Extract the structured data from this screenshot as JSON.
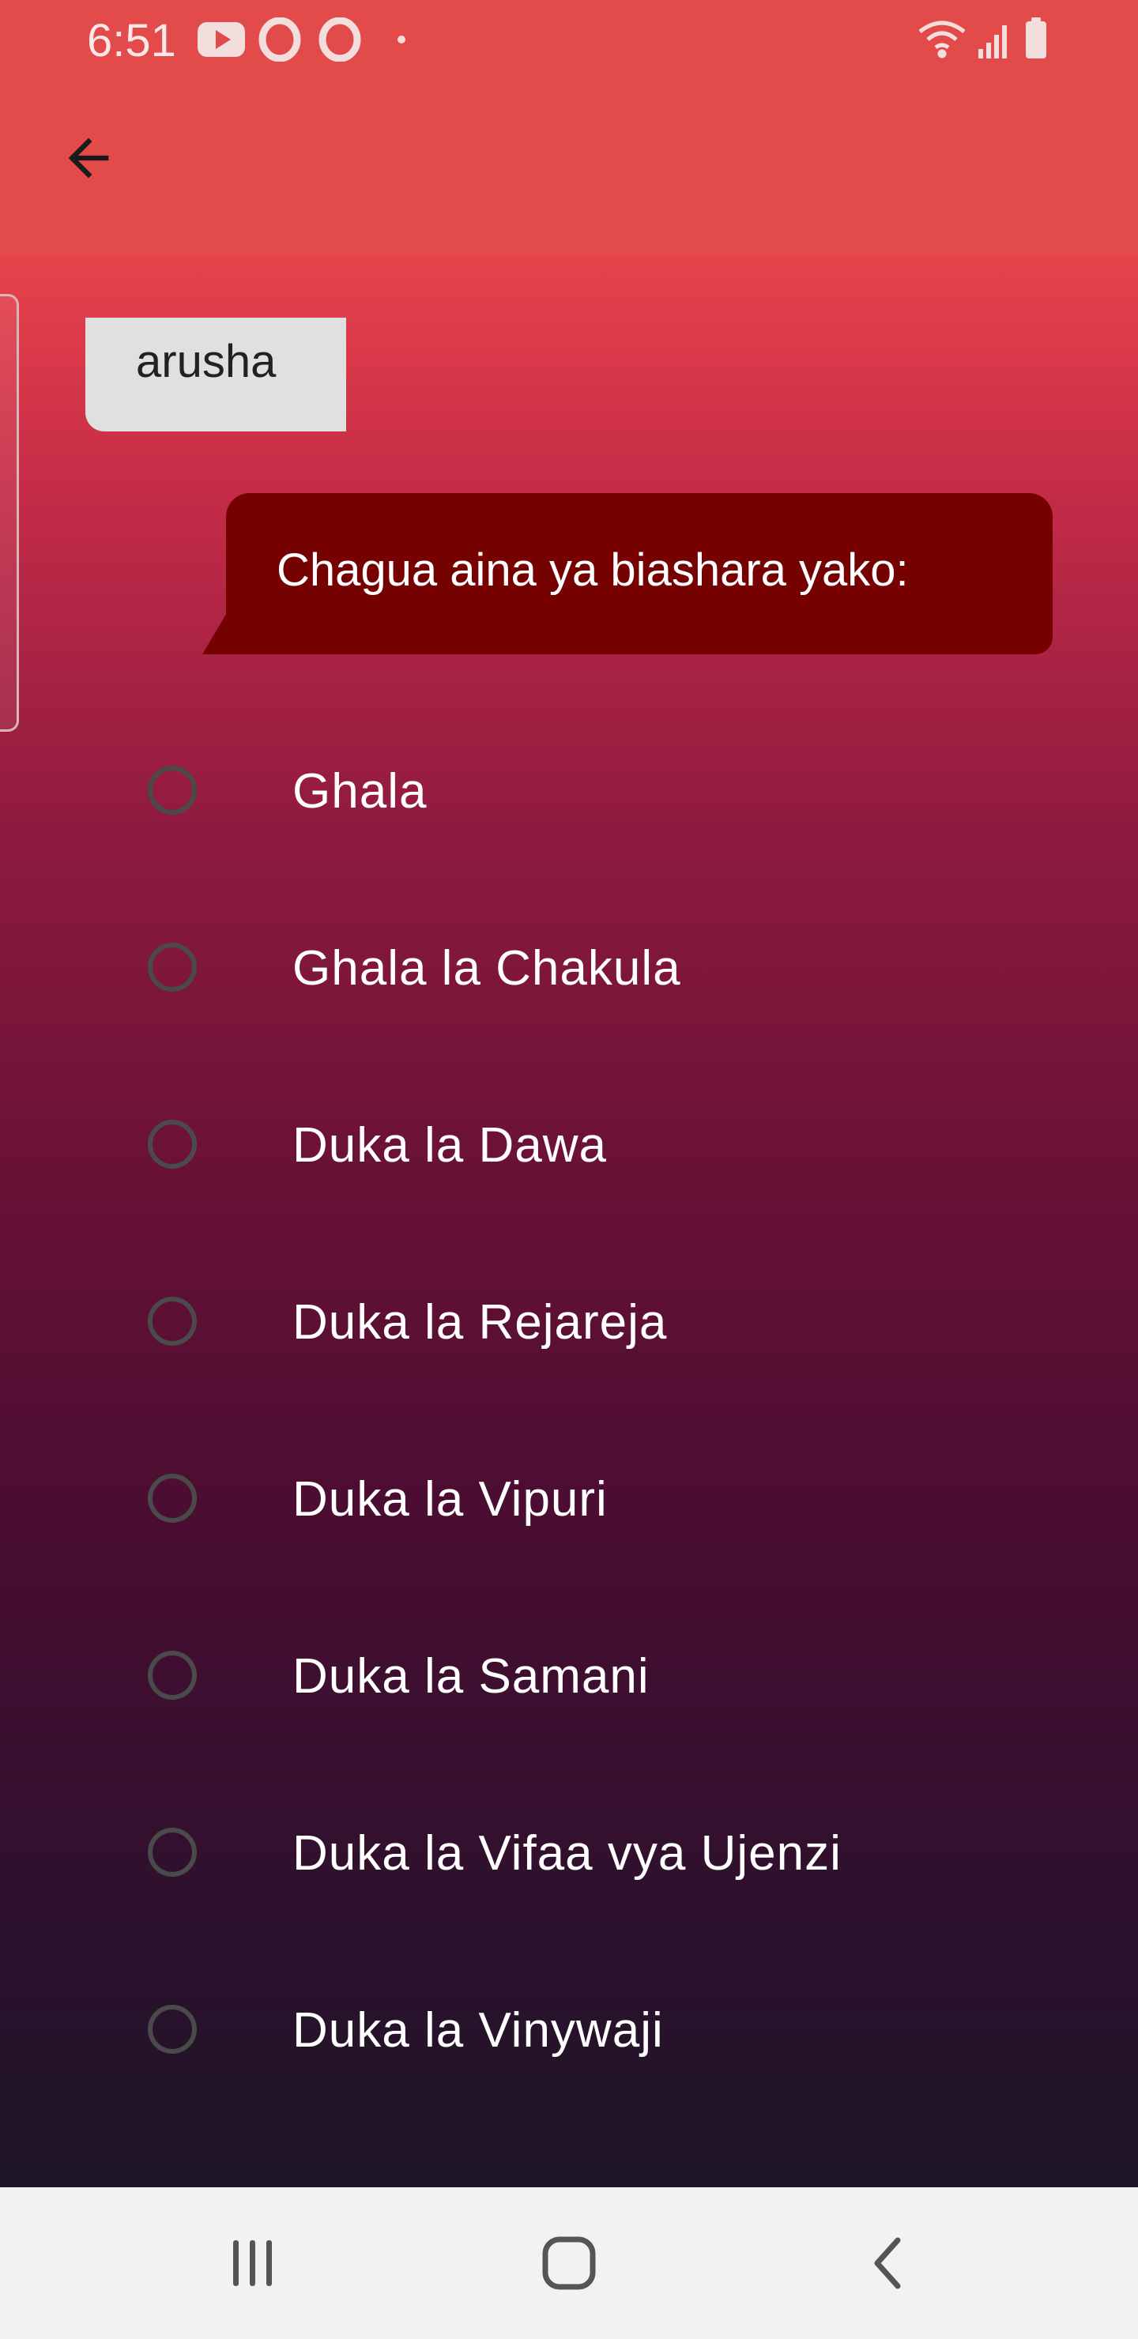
{
  "status_bar": {
    "time": "6:51",
    "left_icons": [
      "youtube-icon",
      "opera-icon",
      "opera-icon",
      "dot-icon"
    ],
    "right_icons": [
      "wifi-icon",
      "signal-icon",
      "battery-icon"
    ]
  },
  "app_bar": {
    "back_icon": "arrow-back-icon"
  },
  "chat": {
    "user_message": "arusha",
    "bot_message": "Chagua aina ya biashara yako:"
  },
  "options": [
    {
      "label": "Ghala",
      "selected": false
    },
    {
      "label": "Ghala la Chakula",
      "selected": false
    },
    {
      "label": "Duka la Dawa",
      "selected": false
    },
    {
      "label": "Duka la Rejareja",
      "selected": false
    },
    {
      "label": "Duka la Vipuri",
      "selected": false
    },
    {
      "label": "Duka la Samani",
      "selected": false
    },
    {
      "label": "Duka la Vifaa vya Ujenzi",
      "selected": false
    },
    {
      "label": "Duka la Vinywaji",
      "selected": false
    }
  ],
  "nav_bar": {
    "icons": [
      "recent-apps-icon",
      "home-icon",
      "back-icon"
    ]
  },
  "colors": {
    "app_bar": "#e34a4a",
    "user_bubble": "#e0e0e0",
    "bot_bubble": "#760101",
    "radio_border": "#4a4a4a",
    "nav_bar": "#f2f2f2"
  }
}
